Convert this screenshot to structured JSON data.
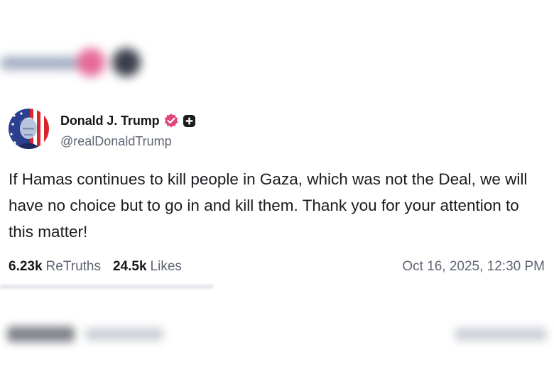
{
  "post": {
    "author": {
      "display_name": "Donald J. Trump",
      "handle": "@realDonaldTrump",
      "verified": true
    },
    "text": "If Hamas continues to kill people in Gaza, which was not the Deal, we will have no choice but to go in and kill them. Thank you for your attention to this matter!",
    "stats": {
      "retruths_count": "6.23k",
      "retruths_label": "ReTruths",
      "likes_count": "24.5k",
      "likes_label": "Likes"
    },
    "timestamp": "Oct 16, 2025, 12:30 PM"
  },
  "colors": {
    "verified_badge": "#e0457b",
    "text_primary": "#17171c",
    "text_secondary": "#5f6573"
  },
  "icons": {
    "verified": "verified-badge-icon",
    "subscriber": "plus-badge-icon",
    "avatar": "profile-avatar"
  }
}
